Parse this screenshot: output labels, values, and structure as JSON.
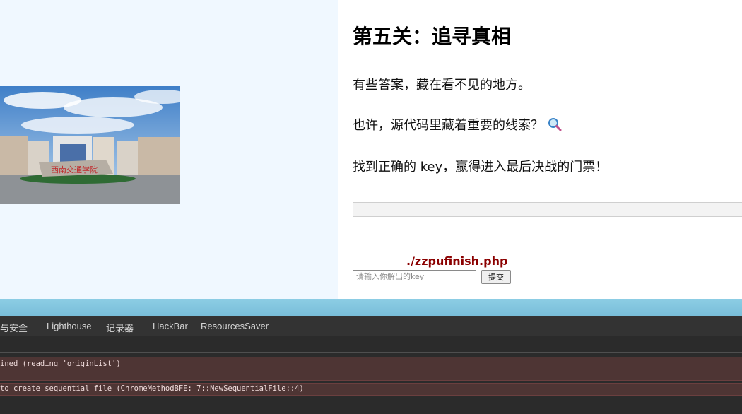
{
  "page": {
    "title": "第五关：追寻真相",
    "paragraphs": [
      "有些答案，藏在看不见的地方。",
      "也许，源代码里藏着重要的线索？",
      "找到正确的 key，赢得进入最后决战的门票！"
    ],
    "hint_icon": "magnifier-icon",
    "file_link": "./zzpufinish.php",
    "key_placeholder": "请输入你解出的key",
    "submit_label": "提交"
  },
  "devtools": {
    "tabs": [
      "与安全",
      "Lighthouse",
      "记录器",
      "HackBar",
      "ResourcesSaver"
    ],
    "console_errors": [
      "ined (reading 'originList')",
      "to create sequential file (ChromeMethodBFE: 7::NewSequentialFile::4)"
    ]
  },
  "colors": {
    "left_bg": "#f0f8ff",
    "link_color": "#8b0000",
    "devtools_bg": "#2b2b2b",
    "error_row_bg": "#4e3534"
  }
}
